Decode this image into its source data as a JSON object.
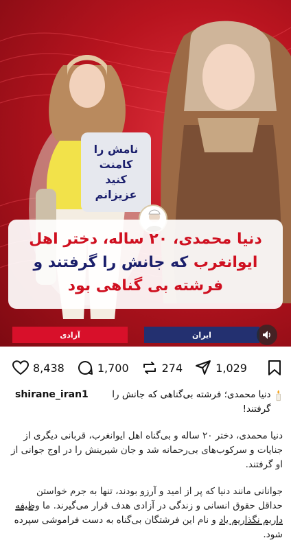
{
  "media": {
    "caption_box_text": "نامش را\nکامنت\nکنید\nعزیزانم",
    "headline": {
      "line1": "دنیا محمدی، ۲۰ ساله، دختر اهل",
      "line2_a": "ایوانغرب",
      "line2_b": " که جانش را گرفتند و",
      "line3": "فرشته بی گناهی بود"
    },
    "strip_left_label": "آزادی",
    "strip_right_label": "ایران"
  },
  "actions": {
    "likes": "8,438",
    "comments": "1,700",
    "reposts": "274",
    "shares": "1,029"
  },
  "post": {
    "username": "shirane_iran1",
    "title_line": "دنیا محمدی؛ فرشته بی‌گناهی که جانش را گرفتند!",
    "paragraph1": "دنیا محمدی، دختر ۲۰ ساله و بی‌گناه اهل ایوانغرب، قربانی دیگری از جنایات و سرکوب‌های بی‌رحمانه شد و جان شیرینش را در اوج جوانی از او گرفتند.",
    "paragraph2_a": "جوانانی مانند دنیا که پر از امید و آرزو بودند، تنها به جرم خواستن حداقل حقوق انسانی و زندگی در آزادی هدف قرار می‌گیرند. ما ",
    "paragraph2_u": "وظیفه داریم نگذاریم یاد",
    "paragraph2_b": " و نام این فرشتگان بی‌گناه به دست فراموشی سپرده شود."
  }
}
